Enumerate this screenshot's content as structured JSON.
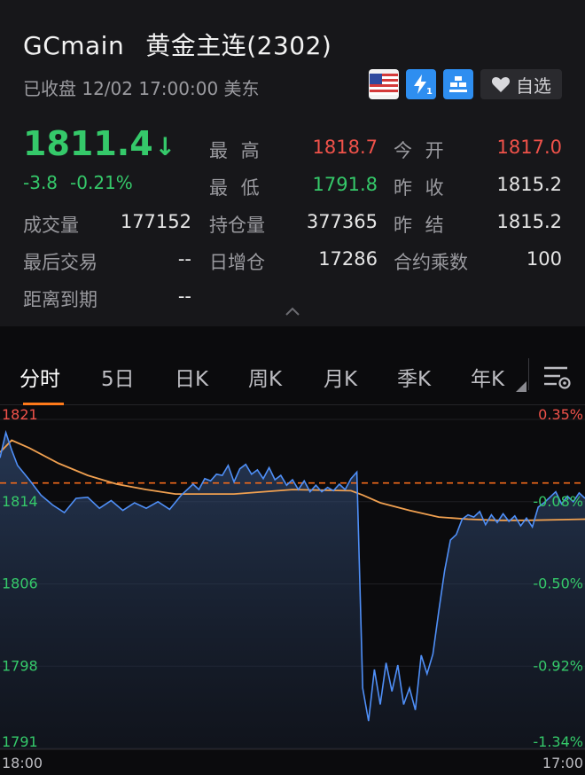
{
  "header": {
    "symbol": "GCmain",
    "name": "黄金主连(2302)",
    "status": "已收盘 12/02 17:00:00 美东",
    "watch_label": "自选",
    "price": "1811.4",
    "arrow": "↓",
    "change": "-3.8",
    "change_pct": "-0.21%"
  },
  "stats": {
    "high_label": "最 高",
    "high": "1818.7",
    "open_label": "今 开",
    "open": "1817.0",
    "low_label": "最 低",
    "low": "1791.8",
    "prev_close_label": "昨 收",
    "prev_close": "1815.2",
    "volume_label": "成交量",
    "volume": "177152",
    "oi_label": "持仓量",
    "oi": "377365",
    "prev_settle_label": "昨 结",
    "prev_settle": "1815.2",
    "last_trade_label": "最后交易",
    "last_trade": "--",
    "oi_change_label": "日增仓",
    "oi_change": "17286",
    "multiplier_label": "合约乘数",
    "multiplier": "100",
    "expiry_label": "距离到期",
    "expiry": "--"
  },
  "tabs": [
    "分时",
    "5日",
    "日K",
    "周K",
    "月K",
    "季K",
    "年K"
  ],
  "colors": {
    "up": "#f0524a",
    "down": "#35c96a",
    "price_line": "#4f8ff7",
    "avg_line": "#f0a050",
    "ref_line": "#f06a1a",
    "tab_active": "#ff7a1a"
  },
  "chart_data": {
    "type": "line",
    "y_ticks_left": [
      "1821",
      "1814",
      "1806",
      "1798",
      "1791"
    ],
    "y_ticks_right": [
      "0.35%",
      "-0.08%",
      "-0.50%",
      "-0.92%",
      "-1.34%"
    ],
    "x_ticks": [
      "18:00",
      "17:00"
    ],
    "ylim": [
      1791,
      1821
    ],
    "reference": 1815.2,
    "series": [
      {
        "key": "price",
        "x": [
          0,
          1,
          2,
          3,
          5,
          7,
          9,
          11,
          13,
          15,
          17,
          19,
          21,
          23,
          25,
          27,
          29,
          31,
          33,
          34,
          35,
          36,
          37,
          38,
          39,
          40,
          41,
          42,
          43,
          44,
          45,
          46,
          47,
          48,
          49,
          50,
          51,
          52,
          53,
          54,
          55,
          56,
          57,
          58,
          59,
          60,
          61,
          62,
          63,
          64,
          65,
          66,
          67,
          68,
          69,
          70,
          71,
          72,
          73,
          74,
          75,
          76,
          77,
          78,
          79,
          80,
          81,
          82,
          83,
          84,
          85,
          86,
          87,
          88,
          89,
          90,
          91,
          92,
          93,
          94,
          95,
          96,
          97,
          98,
          99,
          100
        ],
        "y": [
          1817.5,
          1819.8,
          1818.2,
          1816.8,
          1815.5,
          1814.1,
          1813.2,
          1812.5,
          1813.8,
          1813.9,
          1812.9,
          1813.6,
          1812.7,
          1813.4,
          1812.9,
          1813.5,
          1812.8,
          1814.1,
          1815.1,
          1814.6,
          1815.6,
          1815.4,
          1816.0,
          1815.9,
          1816.8,
          1815.3,
          1816.5,
          1816.9,
          1816.0,
          1816.4,
          1815.6,
          1816.6,
          1815.5,
          1815.9,
          1815.0,
          1815.5,
          1814.6,
          1815.4,
          1814.4,
          1815.0,
          1814.4,
          1814.8,
          1814.5,
          1815.1,
          1814.6,
          1815.6,
          1816.2,
          1796.5,
          1793.5,
          1798.2,
          1795.0,
          1798.8,
          1796.2,
          1798.6,
          1795.0,
          1796.5,
          1794.5,
          1799.5,
          1797.8,
          1799.6,
          1803.5,
          1807.2,
          1810.0,
          1810.5,
          1811.9,
          1812.3,
          1812.1,
          1812.6,
          1811.4,
          1812.3,
          1811.6,
          1812.4,
          1811.7,
          1812.2,
          1811.3,
          1812.0,
          1811.2,
          1813.0,
          1813.4,
          1813.9,
          1814.4,
          1813.3,
          1814.0,
          1813.5,
          1814.3,
          1813.8
        ]
      },
      {
        "key": "average",
        "x": [
          0,
          2,
          5,
          10,
          15,
          20,
          25,
          30,
          40,
          50,
          60,
          62,
          65,
          70,
          75,
          80,
          85,
          90,
          100
        ],
        "y": [
          1818.0,
          1819.1,
          1818.4,
          1817.0,
          1815.9,
          1815.1,
          1814.6,
          1814.2,
          1814.2,
          1814.6,
          1814.5,
          1814.1,
          1813.4,
          1812.7,
          1812.1,
          1811.9,
          1811.8,
          1811.8,
          1811.9
        ]
      }
    ]
  }
}
